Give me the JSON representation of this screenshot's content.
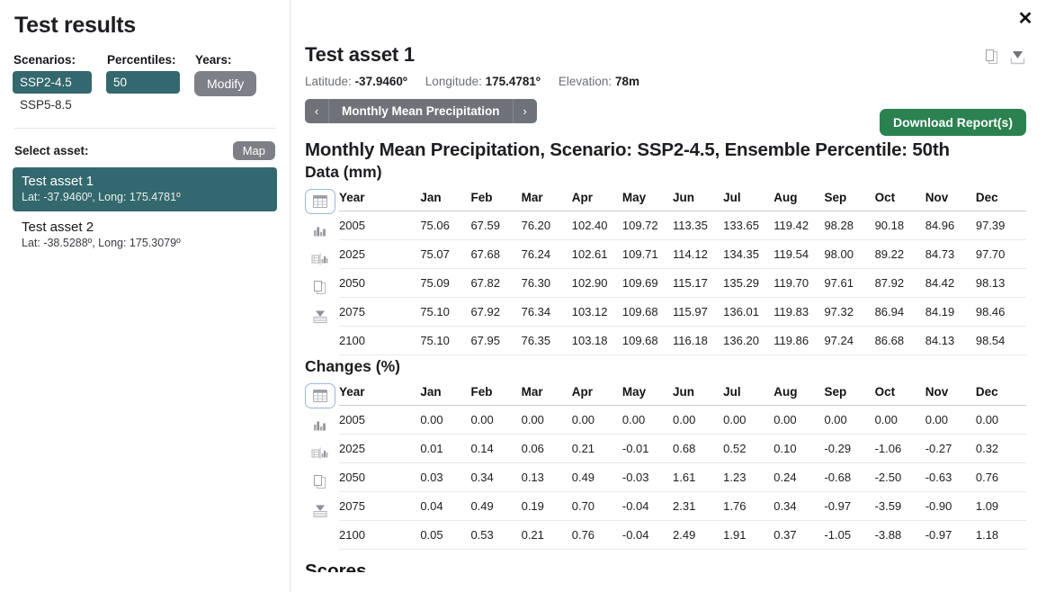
{
  "window": {
    "title": "Test results",
    "close_label": "✕"
  },
  "filters": {
    "scenarios": {
      "label": "Scenarios:",
      "selected": "SSP2-4.5",
      "options": [
        "SSP2-4.5",
        "SSP5-8.5"
      ]
    },
    "percentiles": {
      "label": "Percentiles:",
      "selected": "50"
    },
    "years": {
      "label": "Years:",
      "button": "Modify"
    }
  },
  "asset_selector": {
    "label": "Select asset:",
    "map_button": "Map",
    "assets": [
      {
        "name": "Test asset 1",
        "coords": "Lat: -37.9460º, Long: 175.4781º",
        "selected": true
      },
      {
        "name": "Test asset 2",
        "coords": "Lat: -38.5288º, Long: 175.3079º",
        "selected": false
      }
    ]
  },
  "detail": {
    "asset_title": "Test asset 1",
    "latitude_label": "Latitude:",
    "latitude_value": "-37.9460º",
    "longitude_label": "Longitude:",
    "longitude_value": "175.4781º",
    "elevation_label": "Elevation:",
    "elevation_value": "78m",
    "nav_prev": "‹",
    "nav_next": "›",
    "nav_label": "Monthly Mean Precipitation",
    "download_report_button": "Download Report(s)",
    "section_title": "Monthly Mean Precipitation, Scenario: SSP2-4.5, Ensemble Percentile: 50th",
    "data_subtitle": "Data (mm)",
    "changes_subtitle": "Changes (%)",
    "scores_subtitle": "Scores"
  },
  "colors": {
    "teal": "#33686e",
    "grey_button": "#7d8086",
    "green_button": "#2b8150",
    "active_icon_border": "#9db6da"
  },
  "icon_rail": [
    {
      "name": "table-view-icon",
      "active": true
    },
    {
      "name": "bar-chart-view-icon",
      "active": false
    },
    {
      "name": "table-chart-split-view-icon",
      "active": false
    },
    {
      "name": "copy-icon",
      "active": false
    },
    {
      "name": "download-table-icon",
      "active": false
    }
  ],
  "corner_icons": [
    {
      "name": "copy-icon"
    },
    {
      "name": "download-icon"
    }
  ],
  "chart_data": {
    "type": "table",
    "title": "Monthly Mean Precipitation, Scenario: SSP2-4.5, Ensemble Percentile: 50th",
    "tables": [
      {
        "title": "Data (mm)",
        "columns": [
          "Year",
          "Jan",
          "Feb",
          "Mar",
          "Apr",
          "May",
          "Jun",
          "Jul",
          "Aug",
          "Sep",
          "Oct",
          "Nov",
          "Dec"
        ],
        "rows": [
          [
            "2005",
            "75.06",
            "67.59",
            "76.20",
            "102.40",
            "109.72",
            "113.35",
            "133.65",
            "119.42",
            "98.28",
            "90.18",
            "84.96",
            "97.39"
          ],
          [
            "2025",
            "75.07",
            "67.68",
            "76.24",
            "102.61",
            "109.71",
            "114.12",
            "134.35",
            "119.54",
            "98.00",
            "89.22",
            "84.73",
            "97.70"
          ],
          [
            "2050",
            "75.09",
            "67.82",
            "76.30",
            "102.90",
            "109.69",
            "115.17",
            "135.29",
            "119.70",
            "97.61",
            "87.92",
            "84.42",
            "98.13"
          ],
          [
            "2075",
            "75.10",
            "67.92",
            "76.34",
            "103.12",
            "109.68",
            "115.97",
            "136.01",
            "119.83",
            "97.32",
            "86.94",
            "84.19",
            "98.46"
          ],
          [
            "2100",
            "75.10",
            "67.95",
            "76.35",
            "103.18",
            "109.68",
            "116.18",
            "136.20",
            "119.86",
            "97.24",
            "86.68",
            "84.13",
            "98.54"
          ]
        ]
      },
      {
        "title": "Changes (%)",
        "columns": [
          "Year",
          "Jan",
          "Feb",
          "Mar",
          "Apr",
          "May",
          "Jun",
          "Jul",
          "Aug",
          "Sep",
          "Oct",
          "Nov",
          "Dec"
        ],
        "rows": [
          [
            "2005",
            "0.00",
            "0.00",
            "0.00",
            "0.00",
            "0.00",
            "0.00",
            "0.00",
            "0.00",
            "0.00",
            "0.00",
            "0.00",
            "0.00"
          ],
          [
            "2025",
            "0.01",
            "0.14",
            "0.06",
            "0.21",
            "-0.01",
            "0.68",
            "0.52",
            "0.10",
            "-0.29",
            "-1.06",
            "-0.27",
            "0.32"
          ],
          [
            "2050",
            "0.03",
            "0.34",
            "0.13",
            "0.49",
            "-0.03",
            "1.61",
            "1.23",
            "0.24",
            "-0.68",
            "-2.50",
            "-0.63",
            "0.76"
          ],
          [
            "2075",
            "0.04",
            "0.49",
            "0.19",
            "0.70",
            "-0.04",
            "2.31",
            "1.76",
            "0.34",
            "-0.97",
            "-3.59",
            "-0.90",
            "1.09"
          ],
          [
            "2100",
            "0.05",
            "0.53",
            "0.21",
            "0.76",
            "-0.04",
            "2.49",
            "1.91",
            "0.37",
            "-1.05",
            "-3.88",
            "-0.97",
            "1.18"
          ]
        ]
      }
    ]
  }
}
